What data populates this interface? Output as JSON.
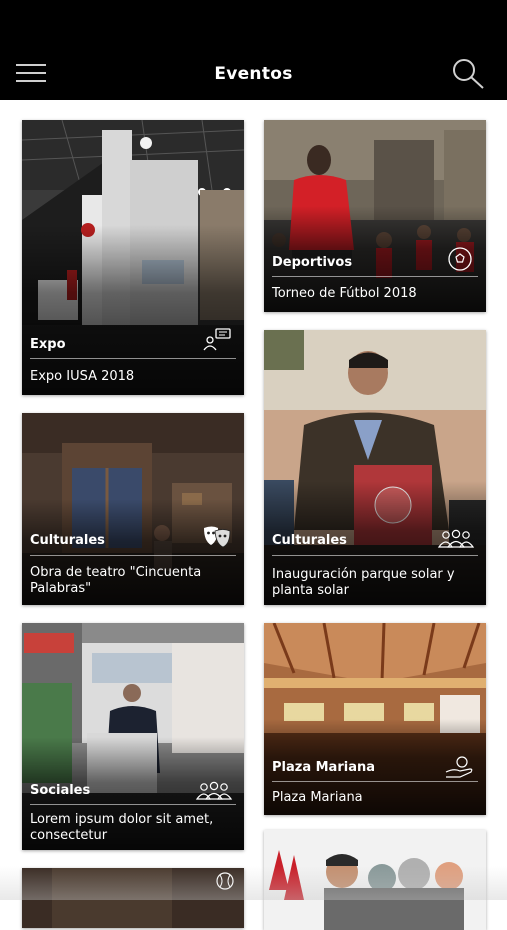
{
  "header": {
    "title": "Eventos",
    "menu_icon": "hamburger-menu-icon",
    "search_icon": "search-icon",
    "background": "#000000"
  },
  "events": [
    {
      "category": "Expo",
      "name": "Expo IUSA 2018",
      "icon": "chat-person-icon"
    },
    {
      "category": "Deportivos",
      "name": "Torneo de Fútbol 2018",
      "icon": "soccer-ball-icon"
    },
    {
      "category": "Culturales",
      "name": "Obra de teatro \"Cincuenta Palabras\"",
      "icon": "theater-masks-icon"
    },
    {
      "category": "Culturales",
      "name": "Inauguración parque solar y planta solar",
      "icon": "group-people-icon"
    },
    {
      "category": "Sociales",
      "name": "Lorem ipsum dolor sit amet, consectetur",
      "icon": "group-people-icon"
    },
    {
      "category": "Plaza Mariana",
      "name": "Plaza Mariana",
      "icon": "hand-coin-icon"
    },
    {
      "category": "",
      "name": "",
      "icon": "baseball-icon"
    },
    {
      "category": "",
      "name": "",
      "icon": ""
    }
  ]
}
